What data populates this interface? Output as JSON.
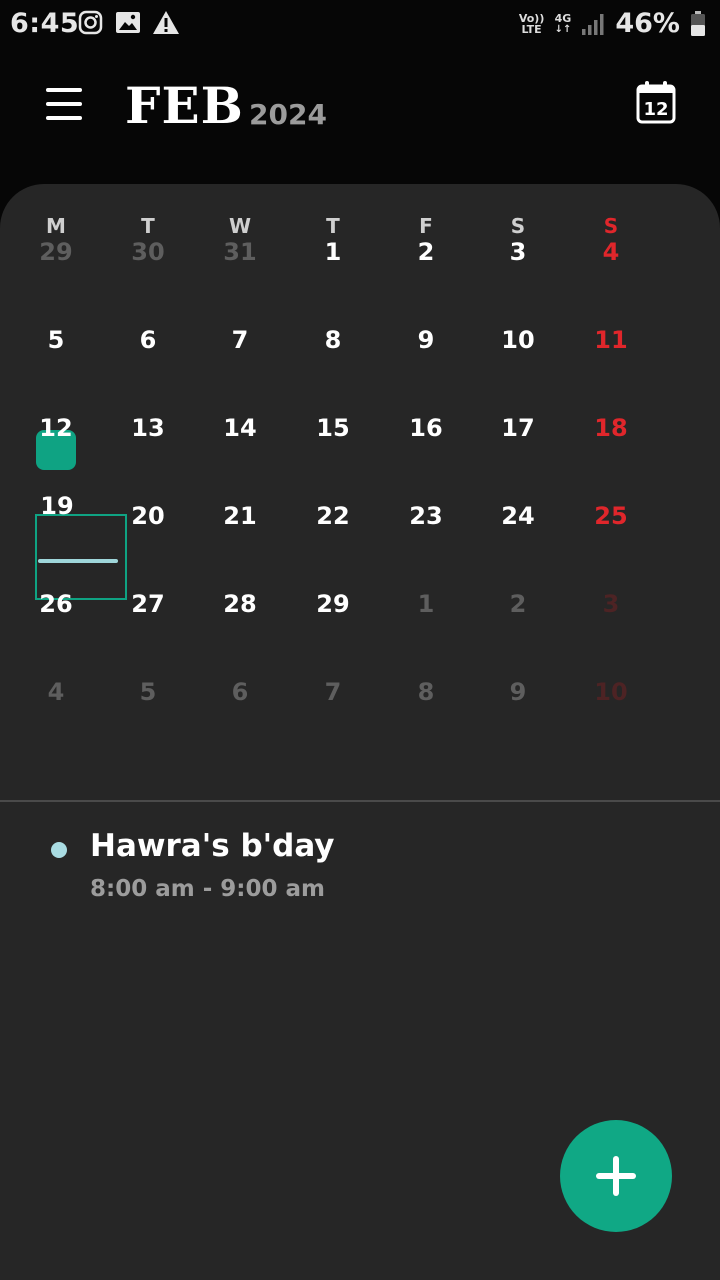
{
  "status_bar": {
    "time": "6:45",
    "icons": [
      "instagram-icon",
      "image-icon",
      "warning-icon"
    ],
    "volte_label": "Vo)) LTE",
    "network_label": "4G",
    "battery_percent": "46%"
  },
  "header": {
    "month": "FEB",
    "year": "2024",
    "today_button_day": "12"
  },
  "calendar": {
    "weekdays": [
      "M",
      "T",
      "W",
      "T",
      "F",
      "S",
      "S"
    ],
    "weeks": [
      [
        {
          "d": "29",
          "m": "prev"
        },
        {
          "d": "30",
          "m": "prev"
        },
        {
          "d": "31",
          "m": "prev"
        },
        {
          "d": "1",
          "m": "cur"
        },
        {
          "d": "2",
          "m": "cur"
        },
        {
          "d": "3",
          "m": "cur"
        },
        {
          "d": "4",
          "m": "cur"
        }
      ],
      [
        {
          "d": "5",
          "m": "cur"
        },
        {
          "d": "6",
          "m": "cur"
        },
        {
          "d": "7",
          "m": "cur"
        },
        {
          "d": "8",
          "m": "cur"
        },
        {
          "d": "9",
          "m": "cur"
        },
        {
          "d": "10",
          "m": "cur"
        },
        {
          "d": "11",
          "m": "cur"
        }
      ],
      [
        {
          "d": "12",
          "m": "cur"
        },
        {
          "d": "13",
          "m": "cur"
        },
        {
          "d": "14",
          "m": "cur"
        },
        {
          "d": "15",
          "m": "cur"
        },
        {
          "d": "16",
          "m": "cur"
        },
        {
          "d": "17",
          "m": "cur"
        },
        {
          "d": "18",
          "m": "cur"
        }
      ],
      [
        {
          "d": "19",
          "m": "cur"
        },
        {
          "d": "20",
          "m": "cur"
        },
        {
          "d": "21",
          "m": "cur"
        },
        {
          "d": "22",
          "m": "cur"
        },
        {
          "d": "23",
          "m": "cur"
        },
        {
          "d": "24",
          "m": "cur"
        },
        {
          "d": "25",
          "m": "cur"
        }
      ],
      [
        {
          "d": "26",
          "m": "cur"
        },
        {
          "d": "27",
          "m": "cur"
        },
        {
          "d": "28",
          "m": "cur"
        },
        {
          "d": "29",
          "m": "cur"
        },
        {
          "d": "1",
          "m": "next"
        },
        {
          "d": "2",
          "m": "next"
        },
        {
          "d": "3",
          "m": "next"
        }
      ],
      [
        {
          "d": "4",
          "m": "next"
        },
        {
          "d": "5",
          "m": "next"
        },
        {
          "d": "6",
          "m": "next"
        },
        {
          "d": "7",
          "m": "next"
        },
        {
          "d": "8",
          "m": "next"
        },
        {
          "d": "9",
          "m": "next"
        },
        {
          "d": "10",
          "m": "next"
        }
      ]
    ],
    "today": "12",
    "selected": "19"
  },
  "events": [
    {
      "title": "Hawra's b'day",
      "time": "8:00 am - 9:00 am",
      "color": "#a9dce2"
    }
  ],
  "colors": {
    "accent": "#0fa383",
    "sunday": "#e0262b",
    "panel": "#262626",
    "background": "#060606"
  },
  "fab": {
    "icon": "plus-icon"
  }
}
